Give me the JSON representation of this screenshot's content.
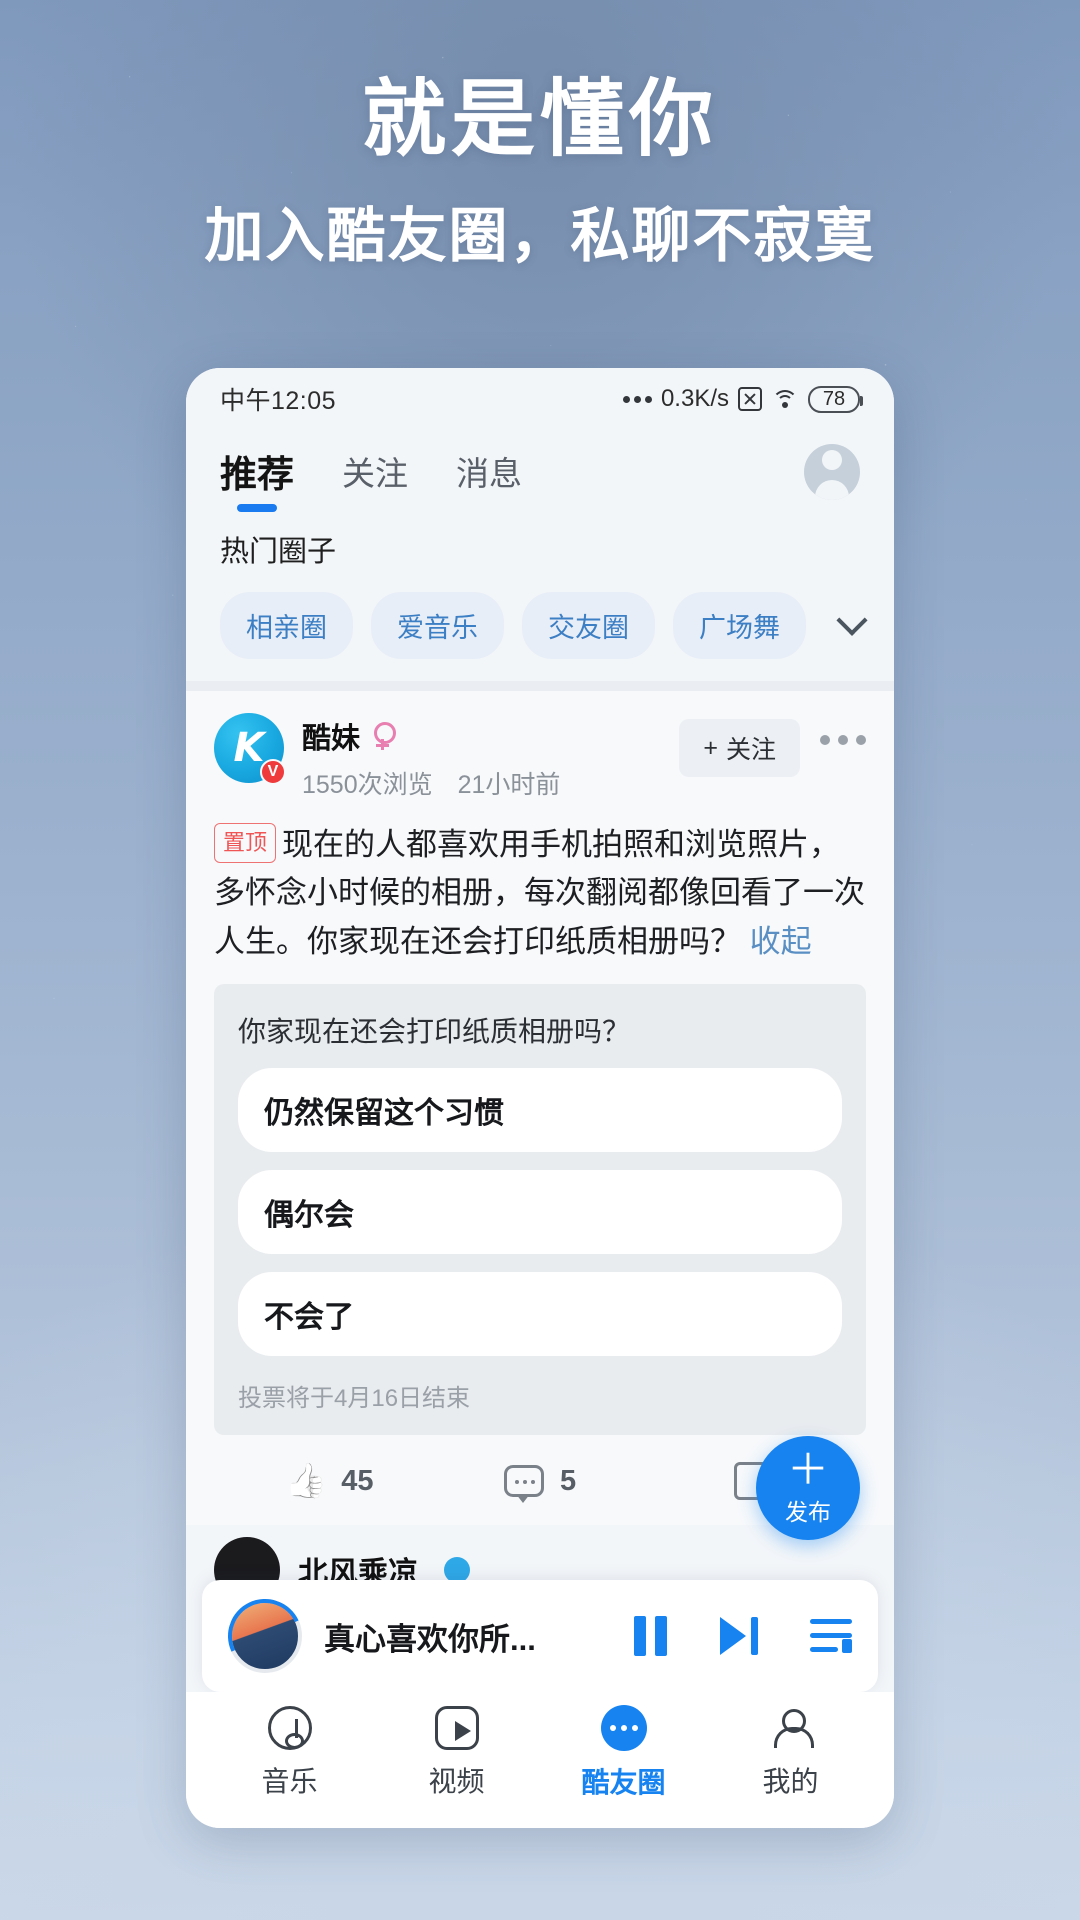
{
  "poster": {
    "headline": "就是懂你",
    "subheadline": "加入酷友圈，私聊不寂寞"
  },
  "statusbar": {
    "time": "中午12:05",
    "network_speed": "0.3K/s",
    "battery": "78",
    "signal_icon": "signal-dots-icon",
    "no_sim_icon": "no-sim-icon",
    "wifi_icon": "wifi-icon",
    "battery_icon": "battery-icon"
  },
  "tabs": [
    {
      "label": "推荐",
      "active": true
    },
    {
      "label": "关注",
      "active": false
    },
    {
      "label": "消息",
      "active": false
    }
  ],
  "profile_icon": "user-avatar-icon",
  "circles": {
    "title": "热门圈子",
    "chips": [
      "相亲圈",
      "爱音乐",
      "交友圈",
      "广场舞"
    ],
    "expand_icon": "chevron-down-icon"
  },
  "post": {
    "avatar_letter": "K",
    "verified_badge": "V",
    "author": "酷妹",
    "gender_icon": "female-icon",
    "views": "1550次浏览",
    "time": "21小时前",
    "follow_label": "关注",
    "follow_plus": "+",
    "more_icon": "more-dots-icon",
    "pin_tag": "置顶",
    "text": "现在的人都喜欢用手机拍照和浏览照片，多怀念小时候的相册，每次翻阅都像回看了一次人生。你家现在还会打印纸质相册吗？",
    "collapse_label": "收起",
    "poll": {
      "question": "你家现在还会打印纸质相册吗？",
      "options": [
        "仍然保留这个习惯",
        "偶尔会",
        "不会了"
      ],
      "end_note": "投票将于4月16日结束"
    },
    "actions": {
      "like_icon": "thumbs-up-icon",
      "like_count": "45",
      "comment_icon": "comment-bubble-icon",
      "comment_count": "5",
      "share_icon": "share-icon"
    }
  },
  "next_post": {
    "author": "北风乘凉",
    "badge_icon": "male-icon"
  },
  "fab": {
    "plus": "＋",
    "label": "发布"
  },
  "player": {
    "cover_icon": "album-cover-icon",
    "title": "真心喜欢你所...",
    "pause_icon": "pause-icon",
    "next_icon": "next-track-icon",
    "playlist_icon": "playlist-icon"
  },
  "bottom_nav": [
    {
      "label": "音乐",
      "icon": "music-note-icon",
      "active": false
    },
    {
      "label": "视频",
      "icon": "video-play-icon",
      "active": false
    },
    {
      "label": "酷友圈",
      "icon": "chat-dots-icon",
      "active": true
    },
    {
      "label": "我的",
      "icon": "person-icon",
      "active": false
    }
  ],
  "colors": {
    "accent": "#1683f0",
    "chip_text": "#3d7fc4",
    "pin_red": "#ef5555",
    "gender_pink": "#e87fb0"
  }
}
